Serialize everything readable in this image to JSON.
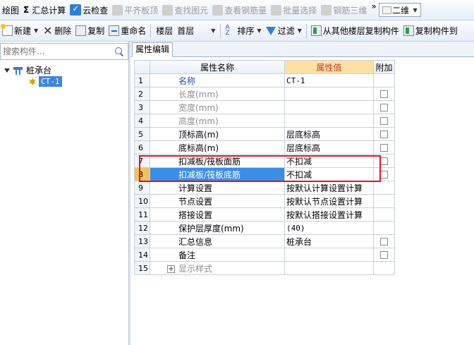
{
  "toolbar1": {
    "draw": "绘图",
    "sigma": "Σ",
    "summary": "汇总计算",
    "cloud_check": "云检查",
    "flush_slab": "平齐板顶",
    "find_elem": "查找图元",
    "view_rebar": "查看钢筋量",
    "batch_select": "批量选择",
    "rebar_3d": "钢筋三维",
    "more": "»",
    "view_mode": "二维"
  },
  "toolbar2": {
    "new": "新建",
    "delete": "删除",
    "copy": "复制",
    "rename": "重命名",
    "floor_label": "楼层",
    "floor_value": "首层",
    "sort": "排序",
    "filter": "过滤",
    "copy_from_floor": "从其他楼层复制构件",
    "copy_to_floor": "复制构件到"
  },
  "left_panel": {
    "search_placeholder": "搜索构件...",
    "tree_root": "桩承台",
    "tree_child": "CT-1"
  },
  "tab": {
    "label": "属性编辑"
  },
  "grid": {
    "headers": {
      "name": "属性名称",
      "value": "属性值",
      "extra": "附加"
    },
    "rows": [
      {
        "num": "1",
        "name": "名称",
        "value": "CT-1"
      },
      {
        "num": "2",
        "name": "长度(mm)",
        "value": ""
      },
      {
        "num": "3",
        "name": "宽度(mm)",
        "value": ""
      },
      {
        "num": "4",
        "name": "高度(mm)",
        "value": ""
      },
      {
        "num": "5",
        "name": "顶标高(m)",
        "value": "层底标高"
      },
      {
        "num": "6",
        "name": "底标高(m)",
        "value": "层底标高"
      },
      {
        "num": "7",
        "name": "扣减板/筏板面筋",
        "value": "不扣减"
      },
      {
        "num": "8",
        "name": "扣减板/筏板底筋",
        "value": "不扣减"
      },
      {
        "num": "9",
        "name": "计算设置",
        "value": "按默认计算设置计算"
      },
      {
        "num": "10",
        "name": "节点设置",
        "value": "按默认节点设置计算"
      },
      {
        "num": "11",
        "name": "搭接设置",
        "value": "按默认搭接设置计算"
      },
      {
        "num": "12",
        "name": "保护层厚度(mm)",
        "value": "(40)"
      },
      {
        "num": "13",
        "name": "汇总信息",
        "value": "桩承台"
      },
      {
        "num": "14",
        "name": "备注",
        "value": ""
      },
      {
        "num": "15",
        "name": "显示样式",
        "value": ""
      }
    ],
    "group_expander": "+"
  },
  "colors": {
    "annotation": "#e0151b",
    "selection": "#3a8ee6",
    "header_value_bg": "#fbe2a4",
    "header_value_text": "#c0392b"
  }
}
